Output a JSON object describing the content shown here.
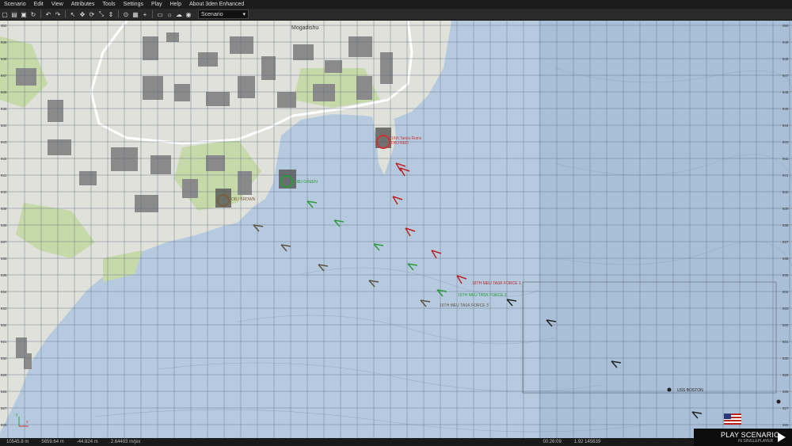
{
  "menu": [
    "Scenario",
    "Edit",
    "View",
    "Attributes",
    "Tools",
    "Settings",
    "Play",
    "Help",
    "About 3den Enhanced"
  ],
  "toolbar": {
    "mode_select": "Scenario",
    "icons": [
      "new-icon",
      "open-icon",
      "save-icon",
      "history-icon",
      "undo-icon",
      "redo-icon",
      "select-icon",
      "translate-icon",
      "rotate-icon",
      "scale-icon",
      "vertical-icon",
      "surface-snap-icon",
      "grid-icon",
      "map-icon",
      "lighting-icon",
      "weather-icon",
      "vision-icon"
    ]
  },
  "map": {
    "city_label": "Mogadishu",
    "sea_color": "#b6cadf",
    "land_color": "#dfe1da",
    "vegetation_color": "#c6d9a8",
    "markers": [
      {
        "name": "ruins-marker",
        "text": "16th Tanks Ruins",
        "color": "#c33"
      },
      {
        "name": "red-objective-marker",
        "text": "OBJ RED",
        "color": "#c33"
      },
      {
        "name": "green-objective-marker",
        "text": "OBJ GREEN",
        "color": "#2a9a3a"
      },
      {
        "name": "brown-objective-marker",
        "text": "OBJ BROWN",
        "color": "#7a6040"
      },
      {
        "name": "task-force-1-marker",
        "text": "16TH MEU TASK FORCE 1",
        "color": "#b22"
      },
      {
        "name": "task-force-2-marker",
        "text": "16TH MEU TASK FORCE 2",
        "color": "#2a9a3a"
      },
      {
        "name": "task-force-3-marker",
        "text": "16TH MEU TASK FORCE 3",
        "color": "#6a5a40"
      },
      {
        "name": "uss-boston-marker",
        "text": "USS BOSTON",
        "color": "#222"
      }
    ],
    "grid_left": [
      "950",
      "949",
      "948",
      "947",
      "946",
      "945",
      "944",
      "943",
      "942",
      "941",
      "940",
      "939",
      "938",
      "937",
      "936",
      "935",
      "934",
      "933",
      "932",
      "931",
      "930",
      "929",
      "928",
      "927",
      "926"
    ],
    "grid_right": [
      "950",
      "949",
      "948",
      "947",
      "946",
      "945",
      "944",
      "943",
      "942",
      "941",
      "940",
      "939",
      "938",
      "937",
      "936",
      "935",
      "934",
      "933",
      "932",
      "931",
      "930",
      "929",
      "928",
      "927",
      "926"
    ],
    "axis_x_label": "x",
    "axis_y_label": "y"
  },
  "status": {
    "pos_x": "10545.8 m",
    "pos_y": "5659.64 m",
    "pos_z": "-44.824 m",
    "scale": "2.64493 m/pix",
    "time": "00:26:09",
    "zoom": "1.92 145639"
  },
  "play": {
    "label": "PLAY SCENARIO",
    "sub": "IN SINGLEPLAYER"
  }
}
